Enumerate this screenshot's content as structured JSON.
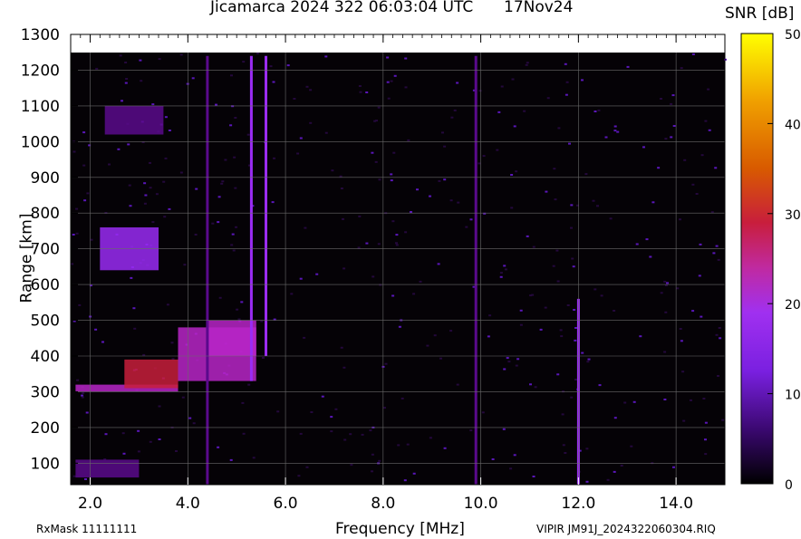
{
  "header": {
    "title": "Jicamarca 2024 322 06:03:04 UTC",
    "date": "17Nov24"
  },
  "footer": {
    "rxmask": "RxMask 11111111",
    "filename": "VIPIR  JM91J_2024322060304.RIQ"
  },
  "chart_data": {
    "type": "heatmap",
    "title": "Jicamarca 2024 322 06:03:04 UTC",
    "xlabel": "Frequency [MHz]",
    "ylabel": "Range [km]",
    "xlim": [
      1.6,
      15.0
    ],
    "ylim": [
      40,
      1300
    ],
    "data_range_ylim": [
      40,
      1240
    ],
    "x_ticks": [
      2.0,
      4.0,
      6.0,
      8.0,
      10.0,
      12.0,
      14.0
    ],
    "x_tick_labels": [
      "2.0",
      "4.0",
      "6.0",
      "8.0",
      "10.0",
      "12.0",
      "14.0"
    ],
    "y_ticks": [
      100,
      200,
      300,
      400,
      500,
      600,
      700,
      800,
      900,
      1000,
      1100,
      1200,
      1300
    ],
    "y_tick_labels": [
      "100",
      "200",
      "300",
      "400",
      "500",
      "600",
      "700",
      "800",
      "900",
      "1000",
      "1100",
      "1200",
      "1300"
    ],
    "grid": true,
    "colorbar": {
      "label": "SNR [dB]",
      "range": [
        0,
        50
      ],
      "ticks": [
        0,
        10,
        20,
        30,
        40,
        50
      ],
      "tick_labels": [
        "0",
        "10",
        "20",
        "30",
        "40",
        "50"
      ],
      "colors": [
        "#000000",
        "#5a0a8c",
        "#9a2cf4",
        "#b826c8",
        "#c81e3c",
        "#d85a00",
        "#ee9600",
        "#ffd400",
        "#ffff00"
      ]
    },
    "regions": [
      {
        "f": [
          1.7,
          3.8
        ],
        "r": [
          300,
          320
        ],
        "snr": 18
      },
      {
        "f": [
          2.7,
          3.8
        ],
        "r": [
          310,
          390
        ],
        "snr": 28
      },
      {
        "f": [
          3.8,
          5.4
        ],
        "r": [
          330,
          480
        ],
        "snr": 17
      },
      {
        "f": [
          4.4,
          5.4
        ],
        "r": [
          400,
          500
        ],
        "snr": 20
      },
      {
        "f": [
          2.2,
          3.4
        ],
        "r": [
          640,
          760
        ],
        "snr": 12
      },
      {
        "f": [
          2.3,
          3.5
        ],
        "r": [
          1020,
          1100
        ],
        "snr": 9
      },
      {
        "f": [
          1.7,
          3.0
        ],
        "r": [
          60,
          110
        ],
        "snr": 7
      }
    ],
    "vertical_lines": [
      {
        "f": 5.3,
        "r": [
          330,
          1240
        ],
        "snr": 13
      },
      {
        "f": 5.6,
        "r": [
          400,
          1240
        ],
        "snr": 12
      },
      {
        "f": 4.4,
        "r": [
          40,
          1240
        ],
        "snr": 9
      },
      {
        "f": 9.9,
        "r": [
          40,
          1240
        ],
        "snr": 7
      },
      {
        "f": 12.0,
        "r": [
          40,
          560
        ],
        "snr": 15
      }
    ]
  }
}
